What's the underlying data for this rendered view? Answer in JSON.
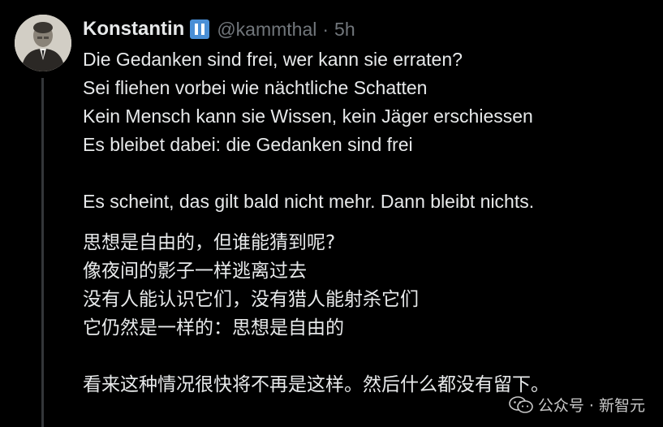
{
  "tweet": {
    "author_name": "Konstantin",
    "badge_label": "II",
    "handle": "@kammthal",
    "separator": "·",
    "timestamp": "5h",
    "german_lines": [
      "Die Gedanken sind frei, wer kann sie erraten?",
      "Sei fliehen vorbei wie nächtliche Schatten",
      "Kein Mensch kann sie Wissen, kein Jäger erschiessen",
      "Es bleibet dabei: die Gedanken sind frei"
    ],
    "german_comment": "Es scheint, das gilt bald nicht mehr. Dann bleibt nichts.",
    "chinese_lines": [
      "思想是自由的，但谁能猜到呢?",
      "像夜间的影子一样逃离过去",
      "没有人能认识它们，没有猎人能射杀它们",
      "它仍然是一样的：思想是自由的"
    ],
    "chinese_comment": "看来这种情况很快将不再是这样。然后什么都没有留下。"
  },
  "watermark": {
    "text": "公众号 · 新智元",
    "icon": "wechat-icon"
  },
  "colors": {
    "background": "#000000",
    "text": "#e7e9ea",
    "muted": "#71767b",
    "badge": "#4a8fd6",
    "thread_line": "#333639"
  }
}
